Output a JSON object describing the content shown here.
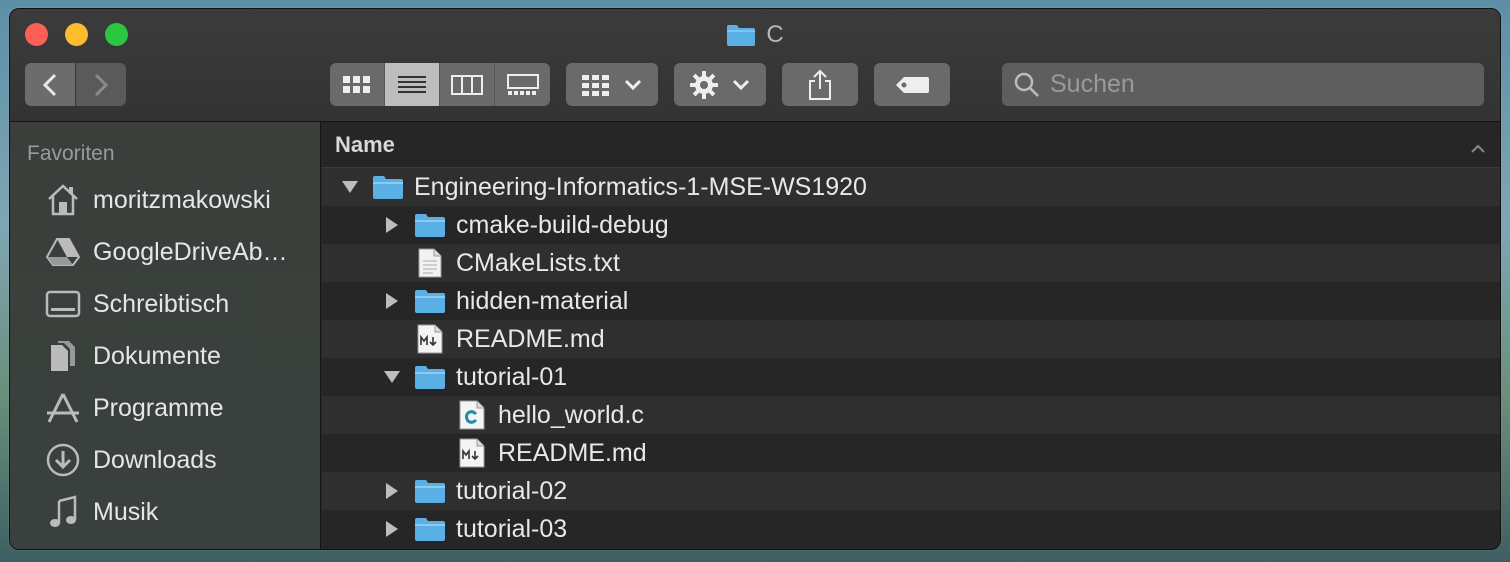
{
  "window": {
    "title": "C"
  },
  "toolbar": {
    "search_placeholder": "Suchen"
  },
  "sidebar": {
    "heading": "Favoriten",
    "items": [
      {
        "label": "moritzmakowski",
        "icon": "home-icon"
      },
      {
        "label": "GoogleDriveAb…",
        "icon": "google-drive-icon"
      },
      {
        "label": "Schreibtisch",
        "icon": "desktop-icon"
      },
      {
        "label": "Dokumente",
        "icon": "documents-icon"
      },
      {
        "label": "Programme",
        "icon": "applications-icon"
      },
      {
        "label": "Downloads",
        "icon": "downloads-icon"
      },
      {
        "label": "Musik",
        "icon": "music-icon"
      }
    ]
  },
  "list": {
    "column_name": "Name",
    "rows": [
      {
        "label": "Engineering-Informatics-1-MSE-WS1920",
        "type": "folder",
        "depth": 0,
        "expanded": true
      },
      {
        "label": "cmake-build-debug",
        "type": "folder",
        "depth": 1,
        "expanded": false
      },
      {
        "label": "CMakeLists.txt",
        "type": "text",
        "depth": 1
      },
      {
        "label": "hidden-material",
        "type": "folder",
        "depth": 1,
        "expanded": false
      },
      {
        "label": "README.md",
        "type": "markdown",
        "depth": 1
      },
      {
        "label": "tutorial-01",
        "type": "folder",
        "depth": 1,
        "expanded": true
      },
      {
        "label": "hello_world.c",
        "type": "c",
        "depth": 2
      },
      {
        "label": "README.md",
        "type": "markdown",
        "depth": 2
      },
      {
        "label": "tutorial-02",
        "type": "folder",
        "depth": 1,
        "expanded": false
      },
      {
        "label": "tutorial-03",
        "type": "folder",
        "depth": 1,
        "expanded": false
      }
    ]
  },
  "colors": {
    "folder": "#5ab0e4",
    "close": "#fc5f56",
    "minimize": "#fdbb2e",
    "maximize": "#2ac840"
  }
}
